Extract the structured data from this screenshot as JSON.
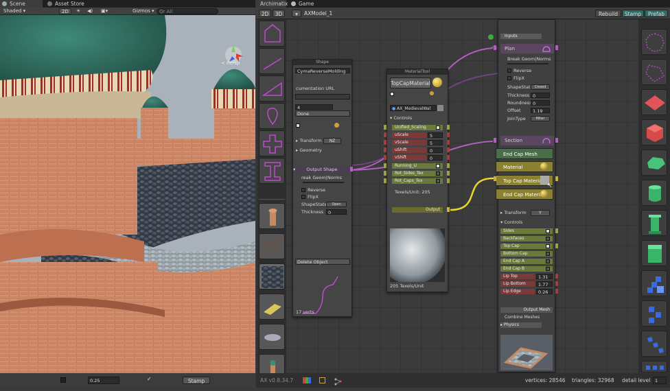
{
  "tabs": {
    "scene": "Scene",
    "asset_store": "Asset Store",
    "archimatix": "Archimatix",
    "game": "Game"
  },
  "scene_toolbar": {
    "shading": "Shaded",
    "mode_2d": "2D",
    "gizmos": "Gizmos",
    "search": "Qr All",
    "persp": "< Persp"
  },
  "scene_bottom": {
    "value": "0.25",
    "stamp": "Stamp"
  },
  "arch_toolbar": {
    "btn_2d": "2D",
    "btn_3d": "3D",
    "model": "AXModel_1",
    "rebuild": "Rebuild",
    "stamp": "Stamp",
    "prefab": "Prefab"
  },
  "shape_node": {
    "title": "Shape",
    "name": "CymaReverseMolding",
    "doc_url": "cumentation URL",
    "num": "4",
    "done": "Done",
    "transform": "Transform",
    "transform_val": "NZ",
    "geometry": "Geometry",
    "output_shape": "Output Shape",
    "break_geom": "reak Geom|Norms",
    "reverse": "Reverse",
    "flipx": "FlipX",
    "shape_state": "ShapeState",
    "shape_state_val": "Open",
    "thickness": "Thickness",
    "thickness_val": "0",
    "delete": "Delete Object",
    "verts": "17 verts"
  },
  "material_node": {
    "title": "MaterialTool",
    "name": "TopCapMaterial",
    "material_field": "AX_MedievalWal",
    "controls": "Controls",
    "unified_scaling": "Unified_Scaling",
    "uscale": "uScale",
    "uscale_val": "5",
    "vscale": "vScale",
    "vscale_val": "5",
    "ushift": "uShift",
    "ushift_val": "0",
    "vshift": "vShift",
    "vshift_val": "0",
    "running_u": "Running_U",
    "rot_sides": "Rot_Sides_Tex",
    "rot_caps": "Rot_Caps_Tex",
    "texels": "Texels/Unit: 205",
    "output": "Output",
    "preview_caption": "205 Texels/Unit"
  },
  "extrude_node": {
    "inputs": "Inputs",
    "plan": "Plan",
    "break_geom": "Break Geom|Norms",
    "reverse": "Reverse",
    "flipx": "FlipX",
    "shape_state": "ShapeState",
    "shape_state_val": "Closed",
    "thickness": "Thickness",
    "thickness_val": "0",
    "roundness": "Roundness",
    "roundness_val": "0",
    "offset": "Offset",
    "offset_val": "1.19",
    "join_type": "JoinType",
    "join_type_val": "Miter",
    "section": "Section",
    "end_cap_mesh": "End Cap Mesh",
    "material": "Material",
    "top_cap_material": "Top Cap Materia",
    "end_cap_material": "End Cap Materia",
    "transform": "Transform",
    "transform_val": "Y",
    "controls": "Controls",
    "sides": "Sides",
    "backfaces": "Backfaces",
    "top_cap": "Top Cap",
    "bottom_cap": "Bottom Cap",
    "end_cap_a": "End Cap A",
    "end_cap_b": "End Cap B",
    "lip_top": "Lip Top",
    "lip_top_val": "1.31",
    "lip_bottom": "Lip Bottom",
    "lip_bottom_val": "1.77",
    "lip_edge": "Lip Edge",
    "lip_edge_val": "0.26",
    "output_mesh": "Output Mesh",
    "combine_meshes": "Combine Meshes",
    "physics": "Physics"
  },
  "status": {
    "version": "AX v0.8.34.7",
    "vertices": "vertices: 28546",
    "triangles": "triangles: 32968",
    "detail_level": "detail level",
    "detail_val": "1"
  }
}
